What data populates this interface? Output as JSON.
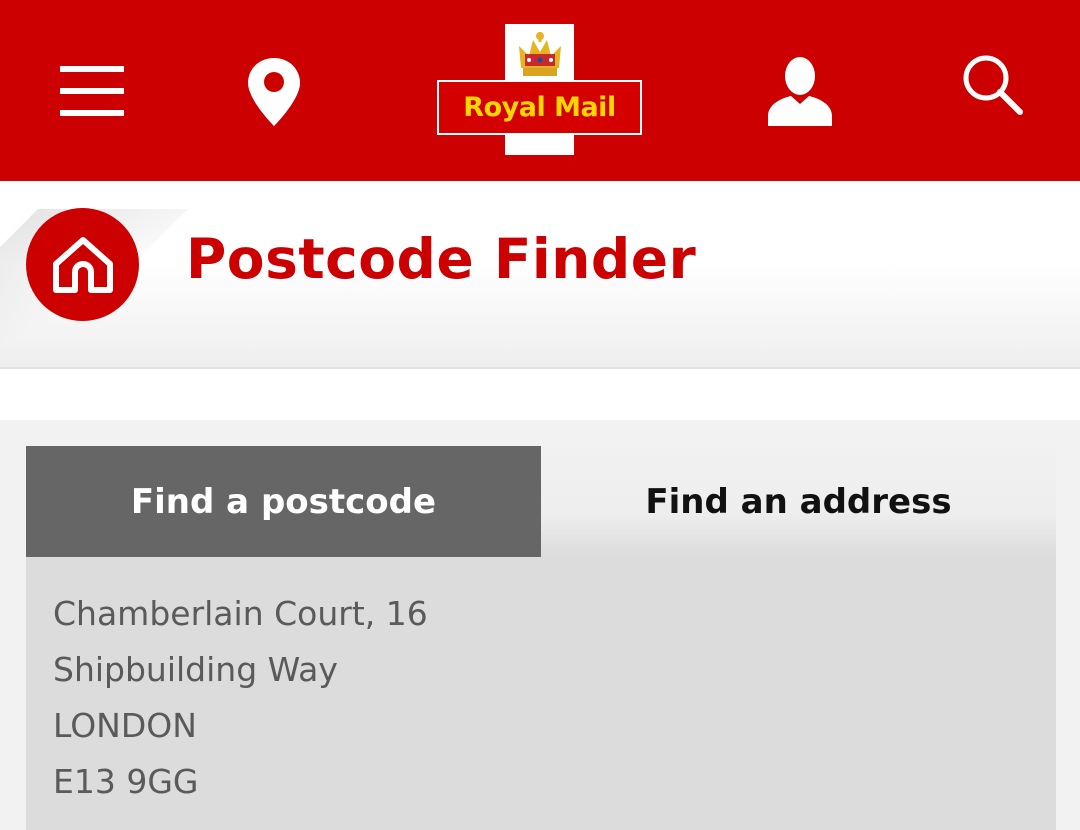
{
  "header": {
    "logo_text": "Royal Mail",
    "icons": [
      "menu-icon",
      "location-pin-icon",
      "account-icon",
      "search-icon"
    ],
    "background_color": "#cc0000"
  },
  "page": {
    "title": "Postcode Finder",
    "home_icon": "home-icon"
  },
  "tabs": [
    {
      "label": "Find a postcode",
      "active": true
    },
    {
      "label": "Find an address",
      "active": false
    }
  ],
  "result": {
    "lines": [
      "Chamberlain Court, 16",
      "Shipbuilding Way",
      "LONDON",
      "E13 9GG"
    ]
  },
  "colors": {
    "brand_red": "#cc0000",
    "logo_yellow": "#ffd700",
    "active_tab": "#666666",
    "panel": "#dcdcdc"
  }
}
